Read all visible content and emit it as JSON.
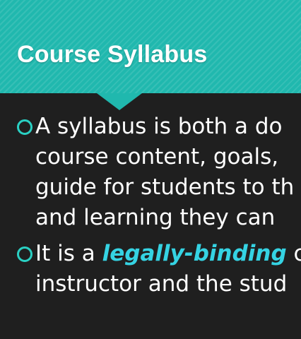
{
  "slide": {
    "title": "Course Syllabus",
    "colors": {
      "header": "#20b8ae",
      "background": "#1f1f1f",
      "bullet_ring": "#2ad0c3",
      "emphasis": "#35d3e3",
      "text": "#ffffff"
    },
    "bullets": [
      {
        "icon": "ring-bullet-icon",
        "lines": [
          "A syllabus is both a do",
          "course content, goals,",
          "guide for students to th",
          "and learning they can"
        ]
      },
      {
        "icon": "ring-bullet-icon",
        "lines": [
          {
            "before": "It is a ",
            "emphasis": "legally-binding",
            "after": " c"
          },
          "instructor and the stud"
        ]
      }
    ]
  }
}
